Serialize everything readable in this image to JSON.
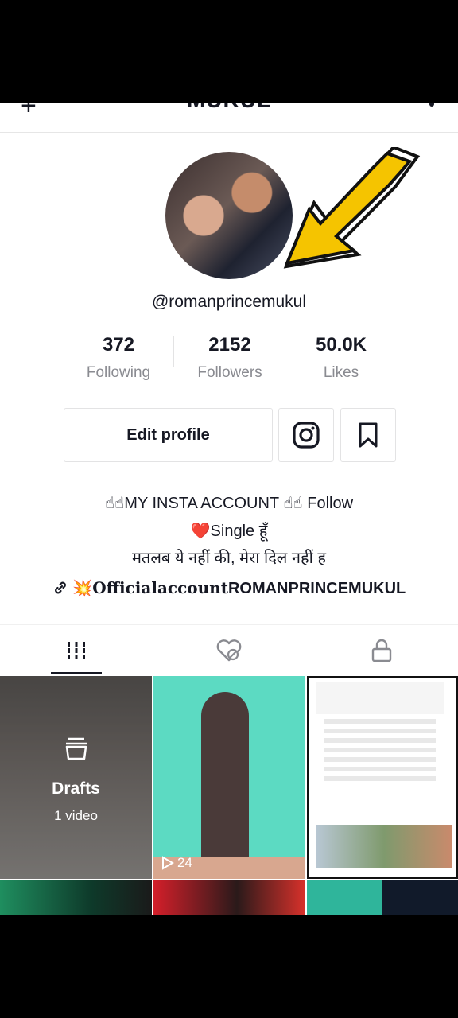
{
  "header": {
    "title": "MUKUL",
    "add_user_icon": "+",
    "more_icon": "more-icon"
  },
  "profile": {
    "username": "@romanprincemukul",
    "stats": [
      {
        "value": "372",
        "label": "Following"
      },
      {
        "value": "2152",
        "label": "Followers"
      },
      {
        "value": "50.0K",
        "label": "Likes"
      }
    ],
    "edit_label": "Edit profile",
    "bio_line1": "☝☝MY INSTA ACCOUNT ☝☝ Follow",
    "bio_line2": "❤️Single हूँ",
    "bio_line3": "मतलब ये नहीं की, मेरा दिल नहीं ह",
    "link_emoji": "💥",
    "link_styled": "Officialaccount",
    "link_plain": "ROMANPRINCEMUKUL"
  },
  "grid": {
    "drafts_label": "Drafts",
    "drafts_count": "1 video",
    "video2_views": "24"
  },
  "colors": {
    "accent": "#fe2c55",
    "arrow_yellow": "#f5c400",
    "text": "#161823",
    "muted": "#8a8b91"
  }
}
